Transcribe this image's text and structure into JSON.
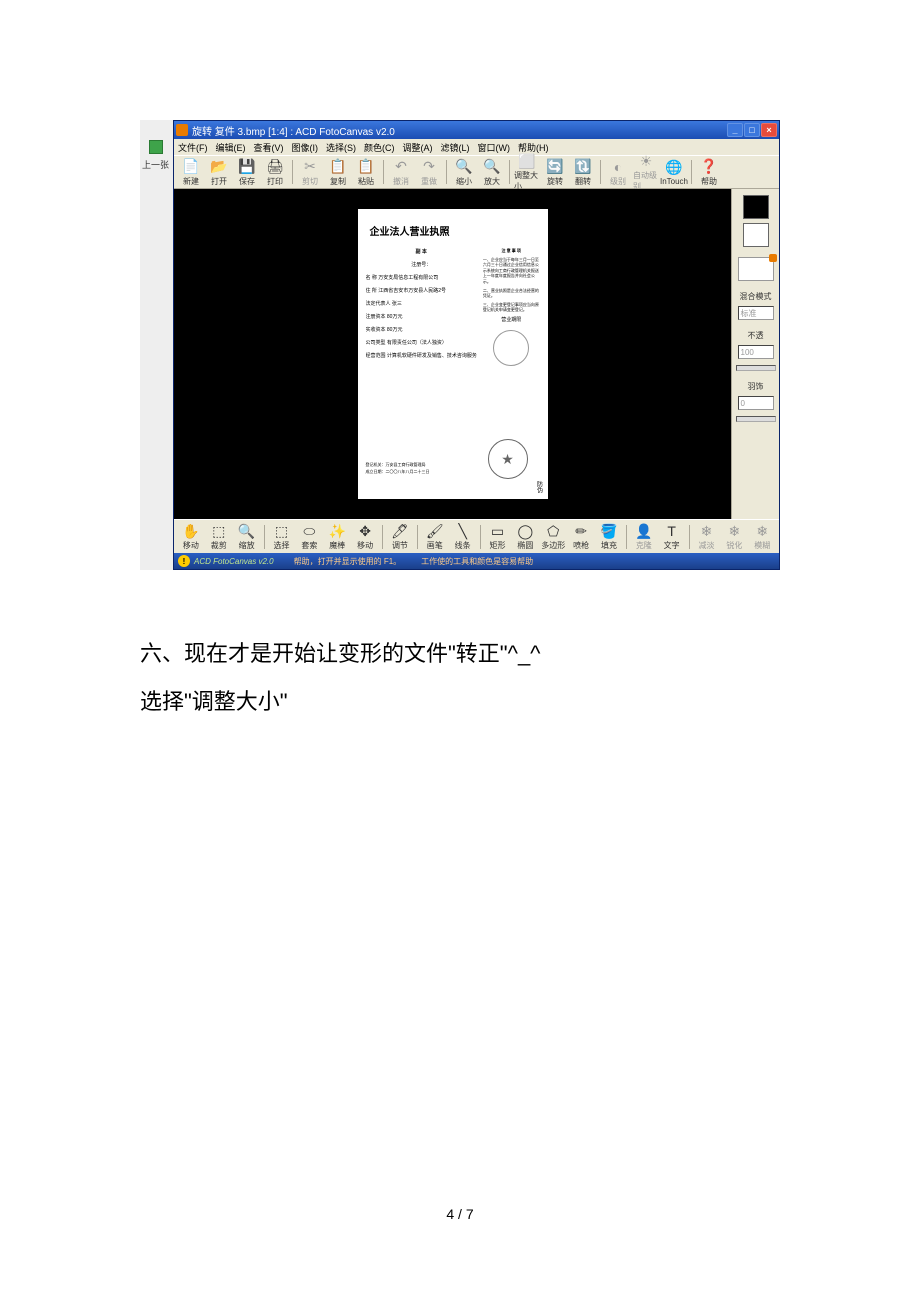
{
  "outerApp": {
    "prevLabel": "上一张"
  },
  "window": {
    "title": "旋转 复件 3.bmp [1:4] : ACD FotoCanvas v2.0",
    "minBtn": "_",
    "maxBtn": "□",
    "closeBtn": "×"
  },
  "menu": {
    "file": "文件(F)",
    "edit": "编辑(E)",
    "view": "查看(V)",
    "image": "图像(I)",
    "select": "选择(S)",
    "color": "颜色(C)",
    "adjust": "调整(A)",
    "filter": "滤镜(L)",
    "windowM": "窗口(W)",
    "help": "帮助(H)"
  },
  "toolbar": [
    {
      "icon": "📄",
      "label": "新建"
    },
    {
      "icon": "📂",
      "label": "打开"
    },
    {
      "icon": "💾",
      "label": "保存"
    },
    {
      "icon": "🖨",
      "label": "打印"
    },
    {
      "sep": true
    },
    {
      "icon": "✂",
      "label": "剪切",
      "disabled": true
    },
    {
      "icon": "📋",
      "label": "复制"
    },
    {
      "icon": "📋",
      "label": "粘贴"
    },
    {
      "sep": true
    },
    {
      "icon": "↶",
      "label": "撤消",
      "disabled": true
    },
    {
      "icon": "↷",
      "label": "重做",
      "disabled": true
    },
    {
      "sep": true
    },
    {
      "icon": "🔍",
      "label": "缩小"
    },
    {
      "icon": "🔍",
      "label": "放大"
    },
    {
      "sep": true
    },
    {
      "icon": "⬜",
      "label": "调整大小"
    },
    {
      "icon": "🔄",
      "label": "旋转"
    },
    {
      "icon": "🔃",
      "label": "翻转"
    },
    {
      "sep": true
    },
    {
      "icon": "◐",
      "label": "级别",
      "disabled": true
    },
    {
      "icon": "☀",
      "label": "自动级别",
      "disabled": true
    },
    {
      "icon": "🌐",
      "label": "InTouch"
    },
    {
      "sep": true
    },
    {
      "icon": "❓",
      "label": "帮助"
    }
  ],
  "document": {
    "title": "企业法人营业执照",
    "subtitleLabel": "副 本",
    "regNoLabel": "注册号：",
    "leftRows": [
      "名    称 万安支局信息工程有限公司",
      "住    所 江西省吉安市万安县人民路2号",
      "法定代表人 张三",
      "注册资本 80万元",
      "实收资本 80万元",
      "公司类型 有限责任公司（法人独资）",
      "经营范围 计算机软硬件研发及销售、技术咨询服务"
    ],
    "rightHeader": "注 意 事 项",
    "rightBody": [
      "一、企业应当于每年三月一日至六月三十日通过企业信用信息公示系统向工商行政管理机关报送上一年度年度报告并向社会公示。",
      "二、营业执照是企业合法经营的凭证。",
      "三、企业变更登记事项应当向原登记机关申请变更登记。"
    ],
    "sealLabel": "营业期限",
    "footer1": "登记机关：万安县工商行政管理局",
    "footer2": "成立日期：二〇〇八年八月二十三日",
    "stampSide": "防伪"
  },
  "rightPanel": {
    "blendLabel": "混合模式",
    "blendValue": "标准",
    "opacityLabel": "不透",
    "opacityValue": "100",
    "featherLabel": "羽饰",
    "featherValue": "0"
  },
  "bottomToolbar": [
    {
      "icon": "✋",
      "label": "移动"
    },
    {
      "icon": "⬚",
      "label": "裁剪"
    },
    {
      "icon": "🔍",
      "label": "缩放"
    },
    {
      "sep": true
    },
    {
      "icon": "⬚",
      "label": "选择"
    },
    {
      "icon": "⬭",
      "label": "套索"
    },
    {
      "icon": "✨",
      "label": "魔棒"
    },
    {
      "icon": "✥",
      "label": "移动"
    },
    {
      "sep": true
    },
    {
      "icon": "🖊",
      "label": "调节"
    },
    {
      "sep": true
    },
    {
      "icon": "🖌",
      "label": "画笔"
    },
    {
      "icon": "╲",
      "label": "线条"
    },
    {
      "sep": true
    },
    {
      "icon": "▭",
      "label": "矩形"
    },
    {
      "icon": "◯",
      "label": "椭圆"
    },
    {
      "icon": "⬠",
      "label": "多边形"
    },
    {
      "icon": "✏",
      "label": "喷枪"
    },
    {
      "icon": "🪣",
      "label": "填充"
    },
    {
      "sep": true
    },
    {
      "icon": "👤",
      "label": "克隆",
      "disabled": true
    },
    {
      "icon": "T",
      "label": "文字"
    },
    {
      "sep": true
    },
    {
      "icon": "❄",
      "label": "减淡",
      "disabled": true
    },
    {
      "icon": "❄",
      "label": "锐化",
      "disabled": true
    },
    {
      "icon": "❄",
      "label": "模糊",
      "disabled": true
    }
  ],
  "statusbar": {
    "version": "ACD FotoCanvas v2.0",
    "hint1": "帮助，打开并显示使用的 F1。",
    "hint2": "工作使的工具和颜色是容易帮助"
  },
  "bodyText": {
    "line1": "六、现在才是开始让变形的文件\"转正\"^_^",
    "line2": "选择\"调整大小\""
  },
  "pageNumber": "4 / 7"
}
